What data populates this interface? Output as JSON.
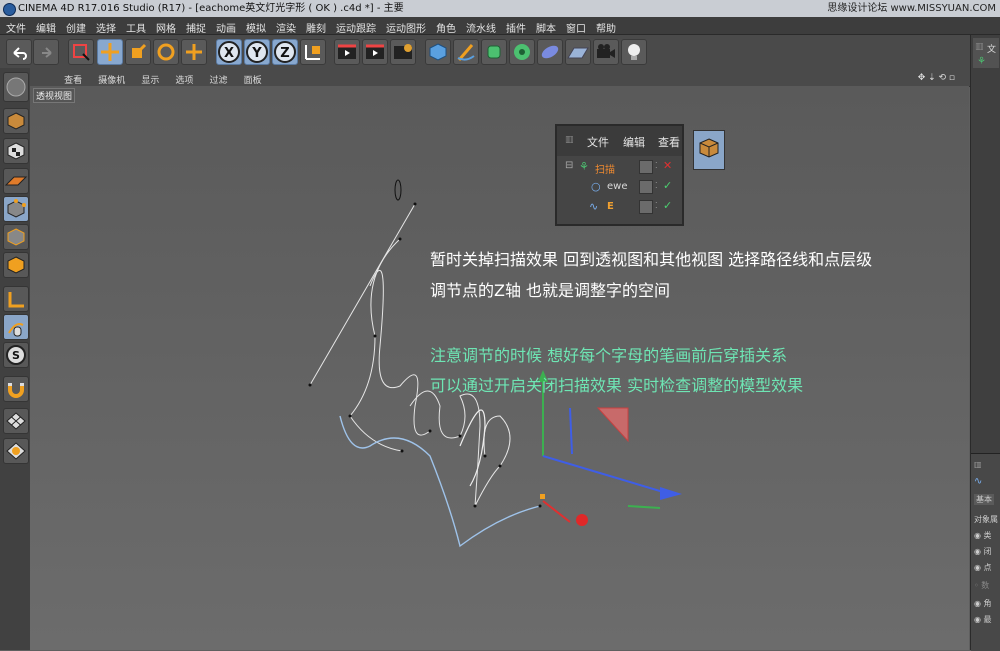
{
  "window": {
    "title": "CINEMA 4D R17.016 Studio (R17) - [eachome英文灯光字形 ( OK ) .c4d *] - 主要",
    "watermark": "思缘设计论坛 www.MISSYUAN.COM"
  },
  "menu": [
    "文件",
    "编辑",
    "创建",
    "选择",
    "工具",
    "网格",
    "捕捉",
    "动画",
    "模拟",
    "渲染",
    "雕刻",
    "运动跟踪",
    "运动图形",
    "角色",
    "流水线",
    "插件",
    "脚本",
    "窗口",
    "帮助"
  ],
  "toolbar": {
    "axis_x": "X",
    "axis_y": "Y",
    "axis_z": "Z"
  },
  "viewport": {
    "tabs": [
      "查看",
      "摄像机",
      "显示",
      "选项",
      "过滤",
      "面板"
    ],
    "label": "透视视图"
  },
  "object_manager": {
    "menu": [
      "文件",
      "编辑",
      "查看"
    ],
    "objects": [
      {
        "name": "扫描",
        "color": "#f08a30",
        "status": "✕"
      },
      {
        "name": "ewe",
        "color": "#d8d8d8",
        "status": "✓"
      },
      {
        "name": "E",
        "color": "#f0a030",
        "status": "✓"
      }
    ]
  },
  "notes": {
    "line1": "暂时关掉扫描效果 回到透视图和其他视图 选择路径线和点层级",
    "line2": "调节点的Z轴 也就是调整字的空间",
    "line3": "注意调节的时候 想好每个字母的笔画前后穿插关系",
    "line4": "可以通过开启关闭扫描效果  实时检查调整的模型效果",
    "white_color": "#ffffff",
    "green_color": "#6ee6b4"
  },
  "right_panel": {
    "top_label": "文",
    "attr_tab": "基本",
    "attr_title": "对象属",
    "attr_items": [
      "类",
      "闭",
      "点",
      "数",
      "角",
      "最"
    ]
  }
}
